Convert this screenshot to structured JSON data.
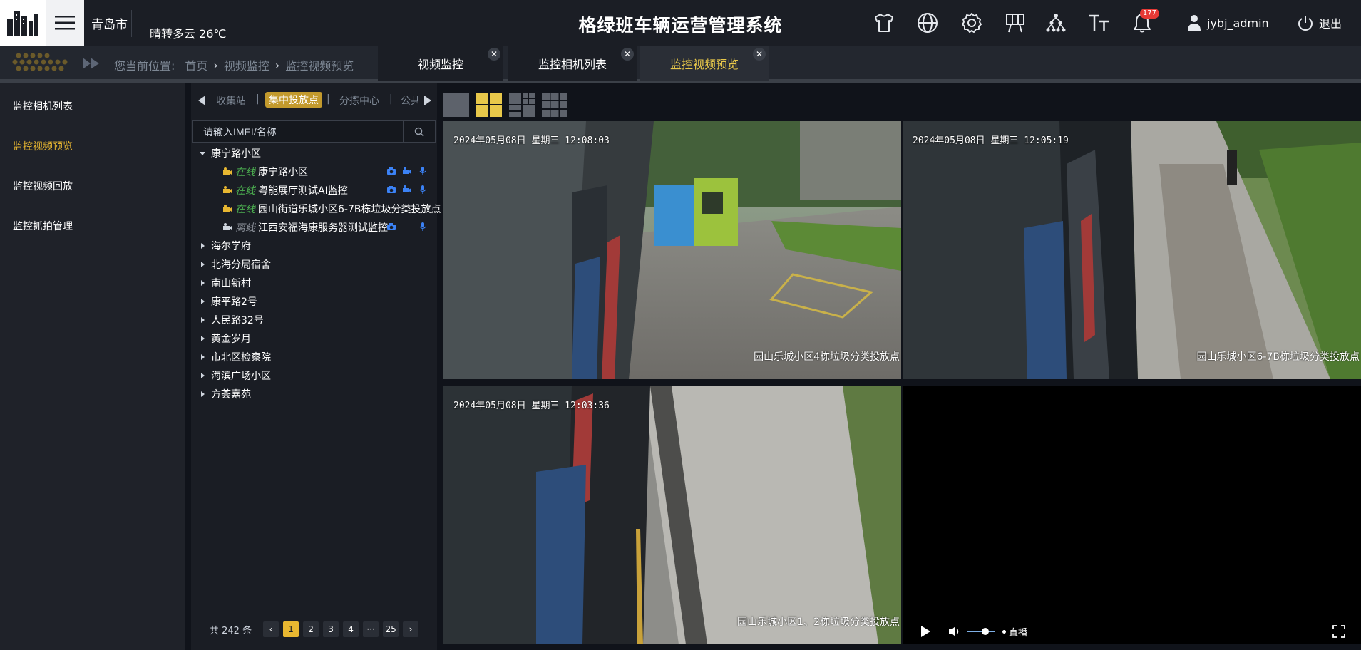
{
  "header": {
    "city": "青岛市",
    "weather": "晴转多云 26℃",
    "app_title": "格绿班车辆运营管理系统",
    "icons": [
      "shirt-icon",
      "globe-icon",
      "gear-icon",
      "easel-icon",
      "org-chart-icon",
      "font-size-icon",
      "bell-icon"
    ],
    "notification_count": "177",
    "username": "jybj_admin",
    "logout_label": "退出"
  },
  "breadcrumb": {
    "label": "您当前位置:",
    "items": [
      "首页",
      "视频监控",
      "监控视频预览"
    ]
  },
  "tabs": [
    {
      "label": "视频监控",
      "active": false
    },
    {
      "label": "监控相机列表",
      "active": false
    },
    {
      "label": "监控视频预览",
      "active": true
    }
  ],
  "sidebar": {
    "items": [
      {
        "label": "监控相机列表",
        "active": false
      },
      {
        "label": "监控视频预览",
        "active": true
      },
      {
        "label": "监控视频回放",
        "active": false
      },
      {
        "label": "监控抓拍管理",
        "active": false
      }
    ]
  },
  "tree": {
    "category_tabs": [
      "收集站",
      "集中投放点",
      "分拣中心",
      "公共"
    ],
    "active_category": "集中投放点",
    "search_placeholder": "请输入IMEI/名称",
    "expanded_group": "康宁路小区",
    "cameras": [
      {
        "status": "在线",
        "name": "康宁路小区",
        "online": true,
        "actions": true
      },
      {
        "status": "在线",
        "name": "粤能展厅测试AI监控",
        "online": true,
        "actions": true
      },
      {
        "status": "在线",
        "name": "园山街道乐城小区6-7B栋垃圾分类投放点",
        "online": true,
        "actions": false
      },
      {
        "status": "离线",
        "name": "江西安福海康服务器测试监控",
        "online": false,
        "actions": true
      }
    ],
    "groups": [
      "海尔学府",
      "北海分局宿舍",
      "南山新村",
      "康平路2号",
      "人民路32号",
      "黄金岁月",
      "市北区检察院",
      "海滨广场小区",
      "方荟嘉苑"
    ]
  },
  "pagination": {
    "total_label": "共 242 条",
    "pages": [
      "1",
      "2",
      "3",
      "4",
      "···",
      "25"
    ],
    "current": "1"
  },
  "layout_buttons": [
    "layout-1x1-button",
    "layout-2x2-button",
    "layout-3x3-button",
    "layout-4x4-button"
  ],
  "videos": [
    {
      "timestamp": "2024年05月08日  星期三  12:08:03",
      "name": "园山乐城小区4栋垃圾分类投放点"
    },
    {
      "timestamp": "2024年05月08日  星期三  12:05:19",
      "name": "园山乐城小区6-7B栋垃圾分类投放点"
    },
    {
      "timestamp": "2024年05月08日  星期三  12:03:36",
      "name": "园山乐城小区1、2栋垃圾分类投放点"
    },
    {
      "timestamp": "",
      "name": ""
    }
  ],
  "player": {
    "live_label": "直播"
  },
  "colors": {
    "accent": "#e8b731",
    "online": "#4caf50",
    "offline": "#8a8f98",
    "header_bg": "#1b1e25"
  }
}
